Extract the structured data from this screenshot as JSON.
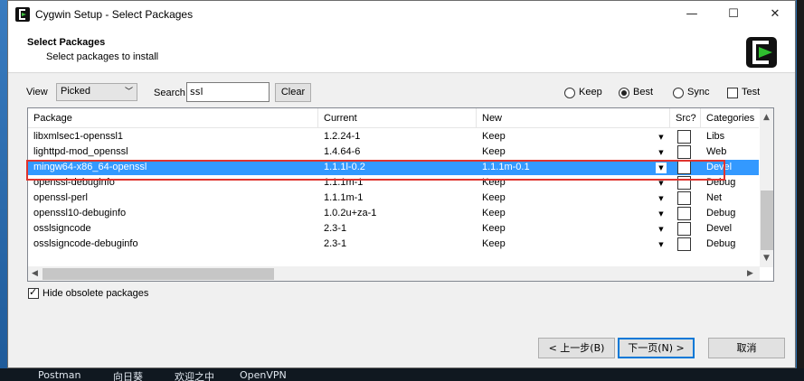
{
  "window": {
    "title": "Cygwin Setup - Select Packages",
    "minimize_glyph": "—",
    "maximize_glyph": "☐",
    "close_glyph": "✕"
  },
  "header": {
    "title": "Select Packages",
    "subtitle": "Select packages to install",
    "logo_icon": "cygwin-logo-icon"
  },
  "toolbar": {
    "view_label": "View",
    "view_value": "Picked",
    "search_label": "Search",
    "search_value": "ssl",
    "clear_label": "Clear",
    "modes": [
      {
        "label": "Keep",
        "selected": false
      },
      {
        "label": "Best",
        "selected": true
      },
      {
        "label": "Sync",
        "selected": false
      }
    ],
    "test_label": "Test",
    "test_checked": false
  },
  "table": {
    "columns": [
      "Package",
      "Current",
      "New",
      "Src?",
      "Categories"
    ],
    "rows": [
      {
        "package": "libxmlsec1-openssl1",
        "current": "1.2.24-1",
        "new": "Keep",
        "category": "Libs"
      },
      {
        "package": "lighttpd-mod_openssl",
        "current": "1.4.64-6",
        "new": "Keep",
        "category": "Web"
      },
      {
        "package": "mingw64-x86_64-openssl",
        "current": "1.1.1l-0.2",
        "new": "1.1.1m-0.1",
        "category": "Devel"
      },
      {
        "package": "openssl-debuginfo",
        "current": "1.1.1m-1",
        "new": "Keep",
        "category": "Debug"
      },
      {
        "package": "openssl-perl",
        "current": "1.1.1m-1",
        "new": "Keep",
        "category": "Net"
      },
      {
        "package": "openssl10-debuginfo",
        "current": "1.0.2u+za-1",
        "new": "Keep",
        "category": "Debug"
      },
      {
        "package": "osslsigncode",
        "current": "2.3-1",
        "new": "Keep",
        "category": "Devel"
      },
      {
        "package": "osslsigncode-debuginfo",
        "current": "2.3-1",
        "new": "Keep",
        "category": "Debug"
      }
    ],
    "selected_row": 2
  },
  "options": {
    "hide_obsolete_label": "Hide obsolete packages",
    "hide_obsolete_checked": true
  },
  "buttons": {
    "back": "< 上一步(B)",
    "next": "下一页(N) >",
    "cancel": "取消"
  },
  "taskbar": {
    "items": [
      "Postman",
      "向日葵",
      "欢迎之中",
      "OpenVPN"
    ]
  },
  "colors": {
    "selection": "#3399ff",
    "highlight_box": "#e0342e"
  }
}
